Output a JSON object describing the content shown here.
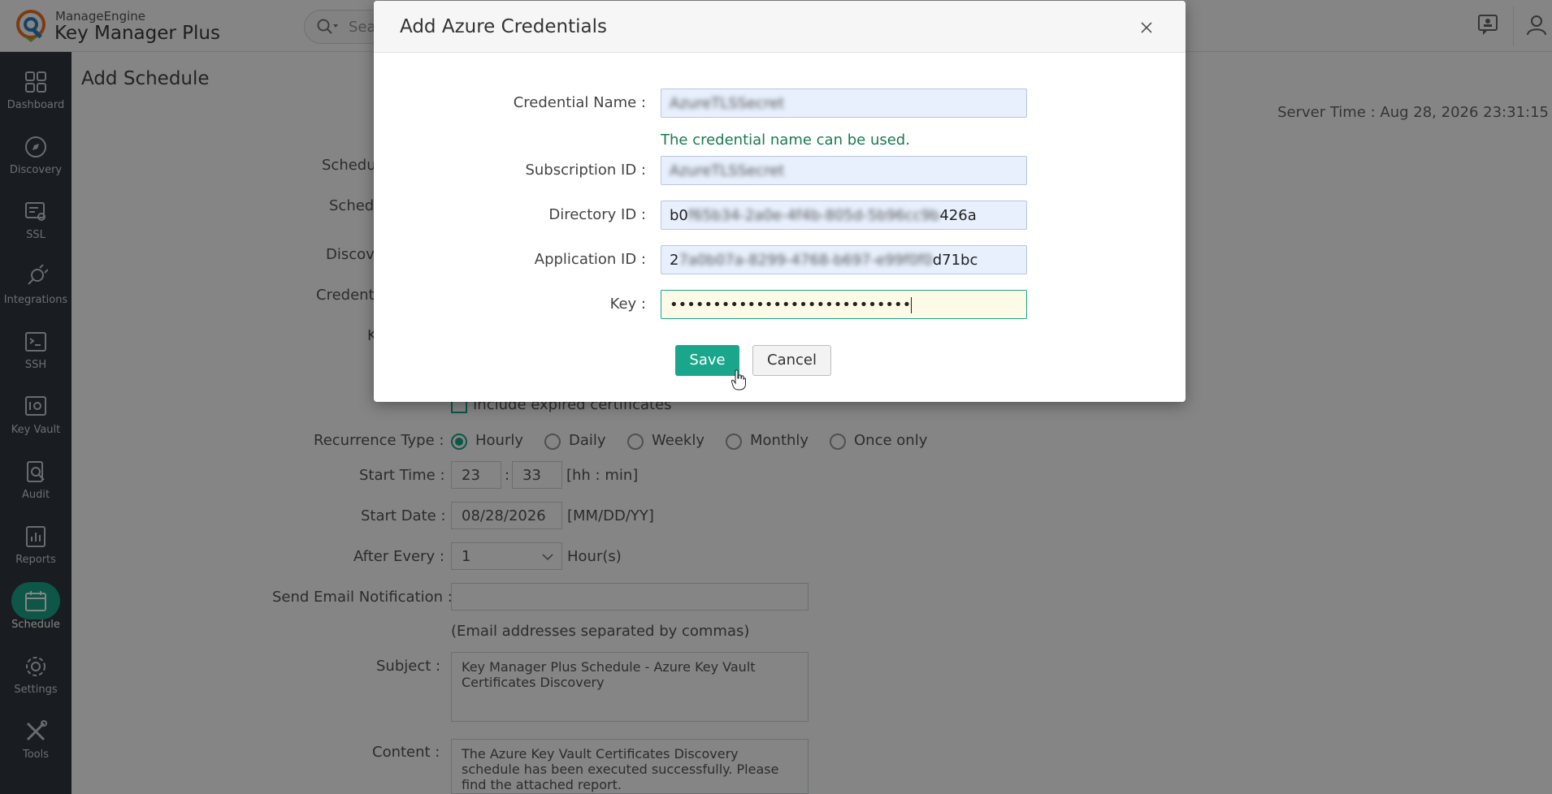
{
  "header": {
    "brand": "ManageEngine",
    "product": "Key Manager Plus",
    "search_placeholder": "Sea"
  },
  "sidebar": {
    "items": [
      {
        "label": "Dashboard",
        "icon": "dashboard-icon"
      },
      {
        "label": "Discovery",
        "icon": "compass-icon"
      },
      {
        "label": "SSL",
        "icon": "certificate-icon"
      },
      {
        "label": "Integrations",
        "icon": "plug-icon"
      },
      {
        "label": "SSH",
        "icon": "terminal-icon"
      },
      {
        "label": "Key Vault",
        "icon": "vault-icon"
      },
      {
        "label": "Audit",
        "icon": "audit-icon"
      },
      {
        "label": "Reports",
        "icon": "reports-icon"
      },
      {
        "label": "Schedule",
        "icon": "calendar-icon",
        "active": true
      },
      {
        "label": "Settings",
        "icon": "gear-icon"
      },
      {
        "label": "Tools",
        "icon": "tools-icon"
      }
    ]
  },
  "page": {
    "title": "Add Schedule",
    "server_time": "Server Time : Aug 28, 2026 23:31:15",
    "partial_labels": [
      "Schedu",
      "Schedu",
      "Discove",
      "Credenti",
      "K"
    ],
    "include_expired": "Include expired certificates",
    "recurrence_label": "Recurrence Type :",
    "recurrence_options": [
      "Hourly",
      "Daily",
      "Weekly",
      "Monthly",
      "Once only"
    ],
    "start_time_label": "Start Time :",
    "start_hour": "23",
    "time_colon": ":",
    "start_min": "33",
    "time_hint": "[hh : min]",
    "start_date_label": "Start Date :",
    "start_date": "08/28/2026",
    "date_hint": "[MM/DD/YY]",
    "after_every_label": "After Every :",
    "after_every_value": "1",
    "after_every_unit": "Hour(s)",
    "email_label": "Send Email Notification :",
    "email_hint": "(Email addresses separated by commas)",
    "subject_label": "Subject :",
    "subject_value": "Key Manager Plus Schedule - Azure Key Vault Certificates Discovery",
    "content_label": "Content :",
    "content_value": "The Azure Key Vault Certificates Discovery schedule has been executed successfully. Please find the attached report."
  },
  "dialog": {
    "title": "Add Azure Credentials",
    "credential_name_label": "Credential Name :",
    "credential_name_value": "AzureTLSSecret",
    "credential_hint": "The credential name can be used.",
    "subscription_label": "Subscription ID :",
    "subscription_value": "AzureTLSSecret",
    "directory_label": "Directory ID :",
    "directory_prefix": "b0",
    "directory_masked": "f65b34-2a0e-4f4b-805d-5b96cc9b",
    "directory_suffix": "426a",
    "application_label": "Application ID :",
    "application_prefix": "2",
    "application_masked": "7a0b07a-8299-4768-b697-e99f0f0",
    "application_suffix": "d71bc",
    "key_label": "Key :",
    "key_value": "••••••••••••••••••••••••••••",
    "save_label": "Save",
    "cancel_label": "Cancel"
  },
  "colors": {
    "accent": "#1aa68a",
    "sidebar": "#30363f"
  }
}
